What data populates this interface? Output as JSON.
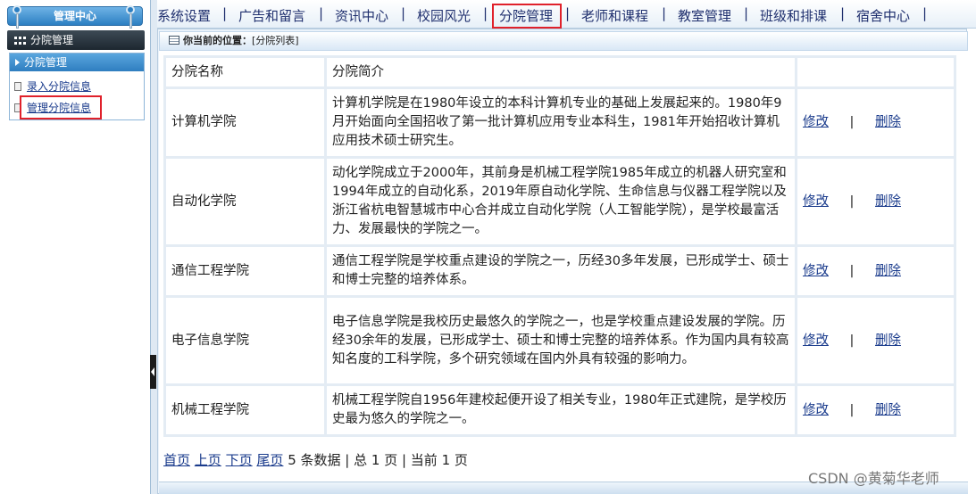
{
  "colors": {
    "accent_blue": "#2c7fc2",
    "nav_text": "#1f2f6e",
    "link": "#1a3b8c",
    "highlight_red": "#e0212b"
  },
  "sidebar": {
    "header_title": "管理中心",
    "module_title": "分院管理",
    "panel_title": "分院管理",
    "links": [
      {
        "label": "录入分院信息"
      },
      {
        "label": "管理分院信息"
      }
    ]
  },
  "nav": {
    "items": [
      {
        "label": "系统设置"
      },
      {
        "label": "广告和留言"
      },
      {
        "label": "资讯中心"
      },
      {
        "label": "校园风光"
      },
      {
        "label": "分院管理"
      },
      {
        "label": "老师和课程"
      },
      {
        "label": "教室管理"
      },
      {
        "label": "班级和排课"
      },
      {
        "label": "宿舍中心"
      }
    ],
    "separator": "|"
  },
  "breadcrumb": {
    "prefix": "你当前的位置：",
    "path": "[分院列表]"
  },
  "table": {
    "headers": {
      "name": "分院名称",
      "intro": "分院简介",
      "ops": ""
    },
    "edit_label": "修改",
    "delete_label": "删除",
    "op_separator": "|",
    "rows": [
      {
        "name": "计算机学院",
        "intro": "计算机学院是在1980年设立的本科计算机专业的基础上发展起来的。1980年9月开始面向全国招收了第一批计算机应用专业本科生，1981年开始招收计算机应用技术硕士研究生。"
      },
      {
        "name": "自动化学院",
        "intro": "动化学院成立于2000年，其前身是机械工程学院1985年成立的机器人研究室和1994年成立的自动化系，2019年原自动化学院、生命信息与仪器工程学院以及浙江省杭电智慧城市中心合并成立自动化学院（人工智能学院），是学校最富活力、发展最快的学院之一。"
      },
      {
        "name": "通信工程学院",
        "intro": "通信工程学院是学校重点建设的学院之一，历经30多年发展，已形成学士、硕士和博士完整的培养体系。"
      },
      {
        "name": "电子信息学院",
        "intro": "电子信息学院是我校历史最悠久的学院之一，也是学校重点建设发展的学院。历经30余年的发展，已形成学士、硕士和博士完整的培养体系。作为国内具有较高知名度的工科学院，多个研究领域在国内外具有较强的影响力。"
      },
      {
        "name": "机械工程学院",
        "intro": "机械工程学院自1956年建校起便开设了相关专业，1980年正式建院，是学校历史最为悠久的学院之一。"
      }
    ]
  },
  "pager": {
    "first": "首页",
    "prev": "上页",
    "next": "下页",
    "last": "尾页",
    "total_records": "5",
    "records_suffix": "条数据 | 总",
    "total_pages": "1",
    "pages_suffix": "页 | 当前",
    "current_page": "1",
    "current_suffix": "页"
  },
  "watermark": "CSDN @黄菊华老师"
}
